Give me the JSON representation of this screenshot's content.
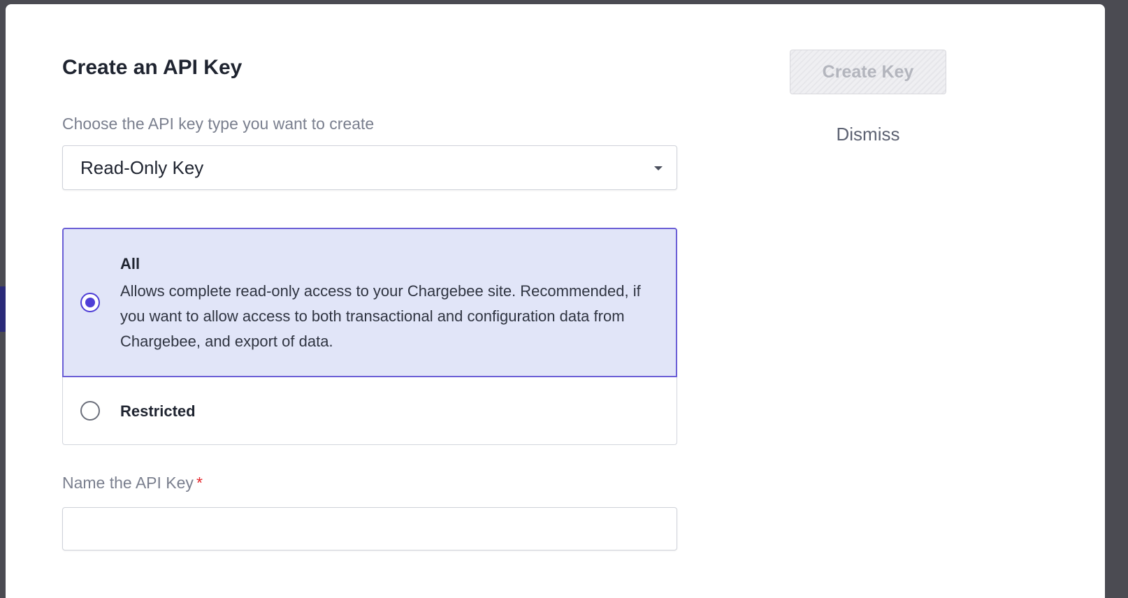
{
  "dialog": {
    "title": "Create an API Key",
    "type_label": "Choose the API key type you want to create",
    "selected_type": "Read-Only Key",
    "access_options": [
      {
        "title": "All",
        "description": "Allows complete read-only access to your Chargebee site. Recommended, if you want to allow access to both transactional and configuration data from Chargebee, and export of data.",
        "selected": true
      },
      {
        "title": "Restricted",
        "selected": false
      }
    ],
    "name_label": "Name the API Key",
    "required_marker": "*",
    "name_value": "",
    "create_button": "Create Key",
    "dismiss_button": "Dismiss"
  },
  "colors": {
    "accent": "#4f3fd6",
    "selected_bg": "#e1e5f8",
    "required": "#e5252a"
  }
}
